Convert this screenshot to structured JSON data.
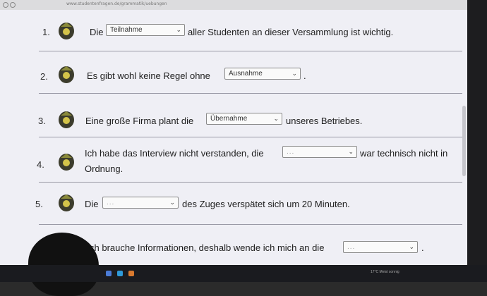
{
  "browser": {
    "address": "www.studentenfragen.de/grammatik/uebungen"
  },
  "questions": [
    {
      "num": "1.",
      "before": "Die",
      "select": "Teilnahme",
      "after": "aller Studenten an dieser Versammlung ist wichtig."
    },
    {
      "num": "2.",
      "before": "Es gibt wohl keine Regel ohne",
      "select": "Ausnahme",
      "after": "."
    },
    {
      "num": "3.",
      "before": "Eine große Firma plant die",
      "select": "Übernahme",
      "after": "unseres Betriebes."
    },
    {
      "num": "4.",
      "before": "Ich habe das Interview nicht verstanden, die",
      "select": "...",
      "after": "war technisch nicht in",
      "after2": "Ordnung."
    },
    {
      "num": "5.",
      "before": "Die",
      "select": "...",
      "after": "des Zuges verspätet sich um 20 Minuten."
    },
    {
      "num": "",
      "before": "ch brauche Informationen, deshalb wende ich mich an die",
      "select": "...",
      "after": "."
    }
  ],
  "chevron": "⌄",
  "taskbar": {
    "weather": "17°C Meist sonnig"
  }
}
